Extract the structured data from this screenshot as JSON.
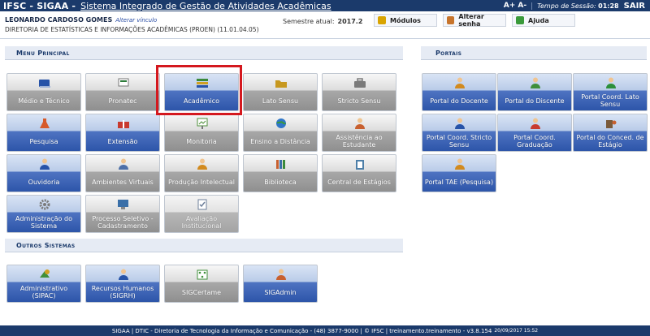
{
  "header": {
    "brand": "IFSC - SIGAA -",
    "subtitle": "Sistema Integrado de Gestão de Atividades Acadêmicas",
    "font_controls": "A+ A-",
    "session_label": "Tempo de Sessão:",
    "session_time": "01:28",
    "logout": "SAIR"
  },
  "user": {
    "name": "LEONARDO CARDOSO GOMES",
    "change_link": "Alterar vínculo",
    "unit": "DIRETORIA DE ESTATÍSTICAS E INFORMAÇÕES ACADÊMICAS (PROEN) (11.01.04.05)",
    "semester_label": "Semestre atual:",
    "semester": "2017.2"
  },
  "user_actions": [
    {
      "label": "Módulos",
      "icon": "modules-icon",
      "color": "#d9a400"
    },
    {
      "label": "Alterar senha",
      "icon": "key-icon",
      "color": "#c7742b"
    },
    {
      "label": "Ajuda",
      "icon": "help-icon",
      "color": "#3a9a3a"
    }
  ],
  "sections": {
    "menu": "Menu Principal",
    "portais": "Portais",
    "outros": "Outros Sistemas"
  },
  "menu": [
    {
      "label": "Médio e Técnico",
      "style": "gray",
      "icon": "book-icon",
      "color": "#2753a8"
    },
    {
      "label": "Pronatec",
      "style": "gray",
      "icon": "pronatec-logo-icon",
      "color": "#2c7b3a"
    },
    {
      "label": "Acadêmico",
      "style": "blue",
      "icon": "books-stack-icon",
      "color": "#3f8f3a"
    },
    {
      "label": "Lato Sensu",
      "style": "gray",
      "icon": "folder-icon",
      "color": "#c7981f"
    },
    {
      "label": "Stricto Sensu",
      "style": "gray",
      "icon": "briefcase-icon",
      "color": "#7a7a7a"
    },
    {
      "label": "Pesquisa",
      "style": "blue",
      "icon": "flask-icon",
      "color": "#d65a2a"
    },
    {
      "label": "Extensão",
      "style": "blue",
      "icon": "gift-box-icon",
      "color": "#c83a2f"
    },
    {
      "label": "Monitoria",
      "style": "gray",
      "icon": "presentation-icon",
      "color": "#4d8f3a"
    },
    {
      "label": "Ensino a Distância",
      "style": "gray",
      "icon": "globe-icon",
      "color": "#2f76c8"
    },
    {
      "label": "Assistência ao Estudante",
      "style": "gray",
      "icon": "student-icon",
      "color": "#c8602f"
    },
    {
      "label": "Ouvidoria",
      "style": "blue",
      "icon": "user-icon",
      "color": "#2753a8"
    },
    {
      "label": "Ambientes Virtuais",
      "style": "gray",
      "icon": "users-icon",
      "color": "#4d6fa8"
    },
    {
      "label": "Produção Intelectual",
      "style": "gray",
      "icon": "writer-icon",
      "color": "#d28a1e"
    },
    {
      "label": "Biblioteca",
      "style": "gray",
      "icon": "library-icon",
      "color": "#c8602f"
    },
    {
      "label": "Central de Estágios",
      "style": "gray",
      "icon": "clipboard-icon",
      "color": "#4d7fa8"
    },
    {
      "label": "Administração do Sistema",
      "style": "blue",
      "icon": "gear-icon",
      "color": "#7a7a7a"
    },
    {
      "label": "Processo Seletivo - Cadastramento",
      "style": "gray",
      "icon": "computer-icon",
      "color": "#3a6fa8"
    },
    {
      "label": "Avaliação Institucional",
      "style": "dim",
      "icon": "form-check-icon",
      "color": "#6d7f9a"
    }
  ],
  "portals": [
    {
      "label": "Portal do Docente",
      "style": "blue",
      "icon": "teacher-icon",
      "color": "#d28a1e"
    },
    {
      "label": "Portal do Discente",
      "style": "blue",
      "icon": "student-portal-icon",
      "color": "#3f8f3a"
    },
    {
      "label": "Portal Coord. Lato Sensu",
      "style": "blue",
      "icon": "coordinator-icon",
      "color": "#2c8f3a"
    },
    {
      "label": "Portal Coord. Stricto Sensu",
      "style": "blue",
      "icon": "coordinator-stricto-icon",
      "color": "#2753a8"
    },
    {
      "label": "Portal Coord. Graduação",
      "style": "blue",
      "icon": "coordinator-graduation-icon",
      "color": "#c83a2f"
    },
    {
      "label": "Portal do Conced. de Estágio",
      "style": "blue",
      "icon": "company-icon",
      "color": "#7a5a3a"
    },
    {
      "label": "Portal TAE (Pesquisa)",
      "style": "blue",
      "icon": "tae-icon",
      "color": "#d28a1e"
    }
  ],
  "others": [
    {
      "label": "Administrativo (SIPAC)",
      "style": "blue",
      "icon": "admin-icon",
      "color": "#3f8f3a"
    },
    {
      "label": "Recursos Humanos (SIGRH)",
      "style": "blue",
      "icon": "hr-icon",
      "color": "#2753a8"
    },
    {
      "label": "SIGCertame",
      "style": "gray",
      "icon": "certame-icon",
      "color": "#3f8f3a"
    },
    {
      "label": "SIGAdmin",
      "style": "blue",
      "icon": "sigadmin-icon",
      "color": "#c8602f"
    }
  ],
  "footer": {
    "text": "SIGAA | DTIC - Diretoria de Tecnologia da Informação e Comunicação - (48) 3877-9000 | © IFSC | treinamento.treinamento - v3.8.154",
    "timestamp": "20/09/2017 15:52"
  }
}
